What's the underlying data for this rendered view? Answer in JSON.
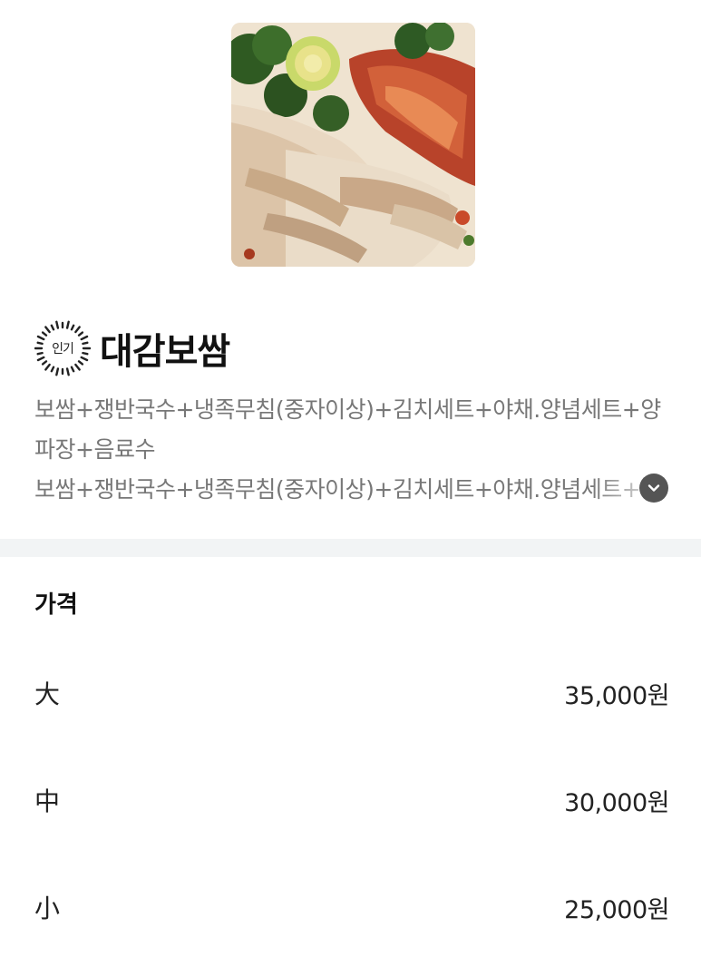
{
  "menu": {
    "badge": "인기",
    "title": "대감보쌈",
    "description": "보쌈+쟁반국수+냉족무침(중자이상)+김치세트+야채.양념세트+양파장+음료수",
    "description_repeat": "보쌈+쟁반국수+냉족무침(중자이상)+김치세트+야채.양념세트+양파장+음료수",
    "expand_icon": "chevron-down-icon"
  },
  "price_section": {
    "heading": "가격",
    "options": [
      {
        "size": "大",
        "price": "35,000원"
      },
      {
        "size": "中",
        "price": "30,000원"
      },
      {
        "size": "小",
        "price": "25,000원"
      }
    ]
  },
  "colors": {
    "divider": "#f2f4f5",
    "description_text": "#777777",
    "expand_button": "#555555"
  }
}
